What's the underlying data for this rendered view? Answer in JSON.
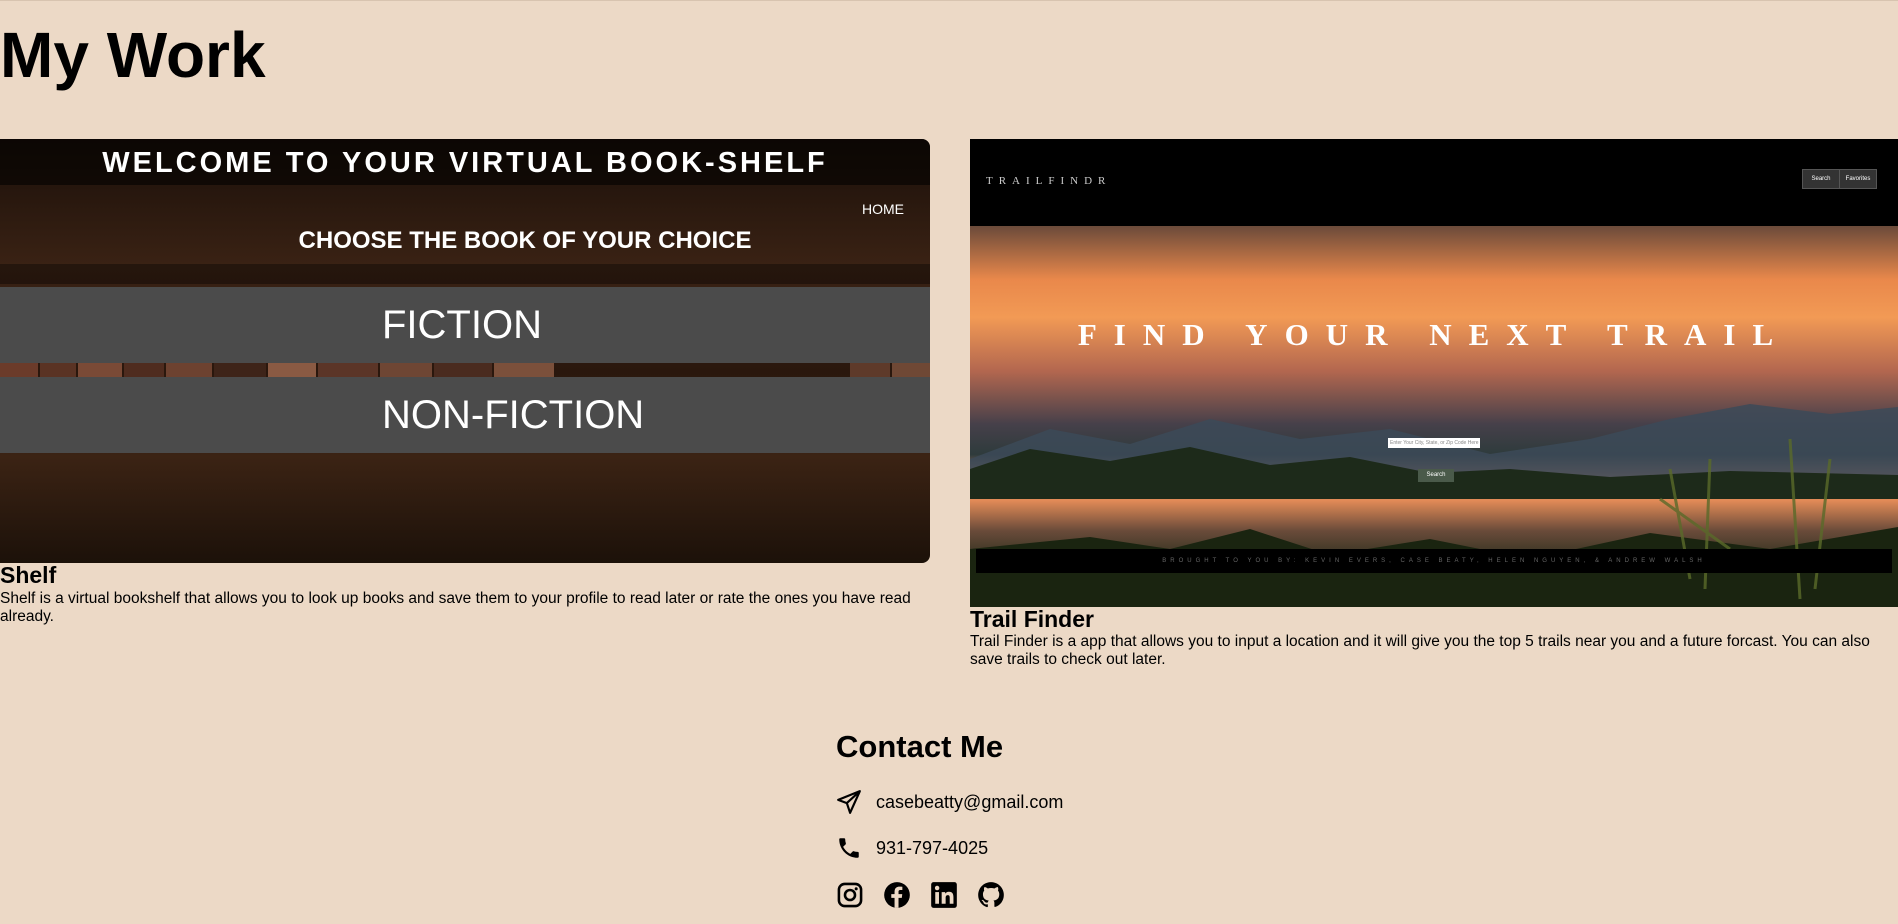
{
  "page": {
    "title": "My Work"
  },
  "projects": [
    {
      "title": "Shelf",
      "description": "Shelf is a virtual bookshelf that allows you to look up books and save them to your profile to read later or rate the ones you have read already.",
      "screenshot": {
        "heading": "WELCOME TO YOUR VIRTUAL BOOK-SHELF",
        "home": "HOME",
        "subheading": "CHOOSE THE BOOK OF YOUR CHOICE",
        "genres": [
          "FICTION",
          "NON-FICTION"
        ]
      }
    },
    {
      "title": "Trail Finder",
      "description": "Trail Finder is a app that allows you to input a location and it will give you the top 5 trails near you and a future forcast. You can also save trails to check out later.",
      "screenshot": {
        "logo": "TRAILFINDR",
        "nav": [
          "Search",
          "Favorites"
        ],
        "hero": "FIND YOUR NEXT TRAIL",
        "input_placeholder": "Enter Your City, State, or Zip Code Here",
        "search_button": "Search",
        "footer": "BROUGHT TO YOU BY: KEVIN EVERS, CASE BEATY, HELEN NGUYEN, & ANDREW WALSH"
      }
    }
  ],
  "contact": {
    "title": "Contact Me",
    "email": "casebeatty@gmail.com",
    "phone": "931-797-4025",
    "socials": [
      "instagram-icon",
      "facebook-icon",
      "linkedin-icon",
      "github-icon"
    ]
  },
  "colors": {
    "background": "#ecd9c6",
    "band": "#4b4b4b",
    "text": "#000000"
  }
}
